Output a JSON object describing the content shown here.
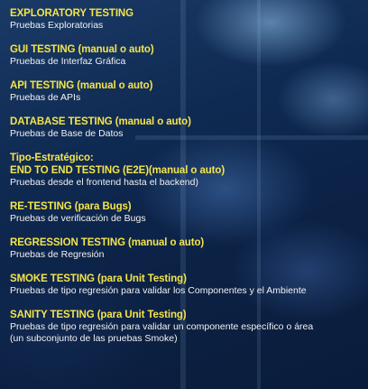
{
  "items": [
    {
      "title": "EXPLORATORY TESTING",
      "desc": "Pruebas Exploratorias"
    },
    {
      "title": "GUI TESTING (manual o auto)",
      "desc": "Pruebas de Interfaz Gráfica"
    },
    {
      "title": "API TESTING (manual o auto)",
      "desc": "Pruebas de APIs"
    },
    {
      "title": "DATABASE TESTING (manual o auto)",
      "desc": "Pruebas de Base de Datos"
    },
    {
      "title_pre": "Tipo-Estratégico:",
      "title": "END TO END TESTING (E2E)(manual o auto)",
      "desc": "Pruebas desde el frontend hasta el backend)"
    },
    {
      "title": "RE-TESTING (para Bugs)",
      "desc": "Pruebas de verificación de Bugs"
    },
    {
      "title": "REGRESSION TESTING (manual o auto)",
      "desc": "Pruebas de Regresión"
    },
    {
      "title": "SMOKE TESTING (para Unit Testing)",
      "desc": "Pruebas de tipo regresión para validar los Componentes y el Ambiente"
    },
    {
      "title": "SANITY TESTING (para Unit Testing)",
      "desc": "Pruebas de tipo regresión para validar un componente específico o área",
      "desc2": "(un subconjunto de las pruebas Smoke)"
    }
  ],
  "colors": {
    "title": "#f4e44a",
    "desc": "#f2f2f2",
    "background": "#0f2a52"
  }
}
